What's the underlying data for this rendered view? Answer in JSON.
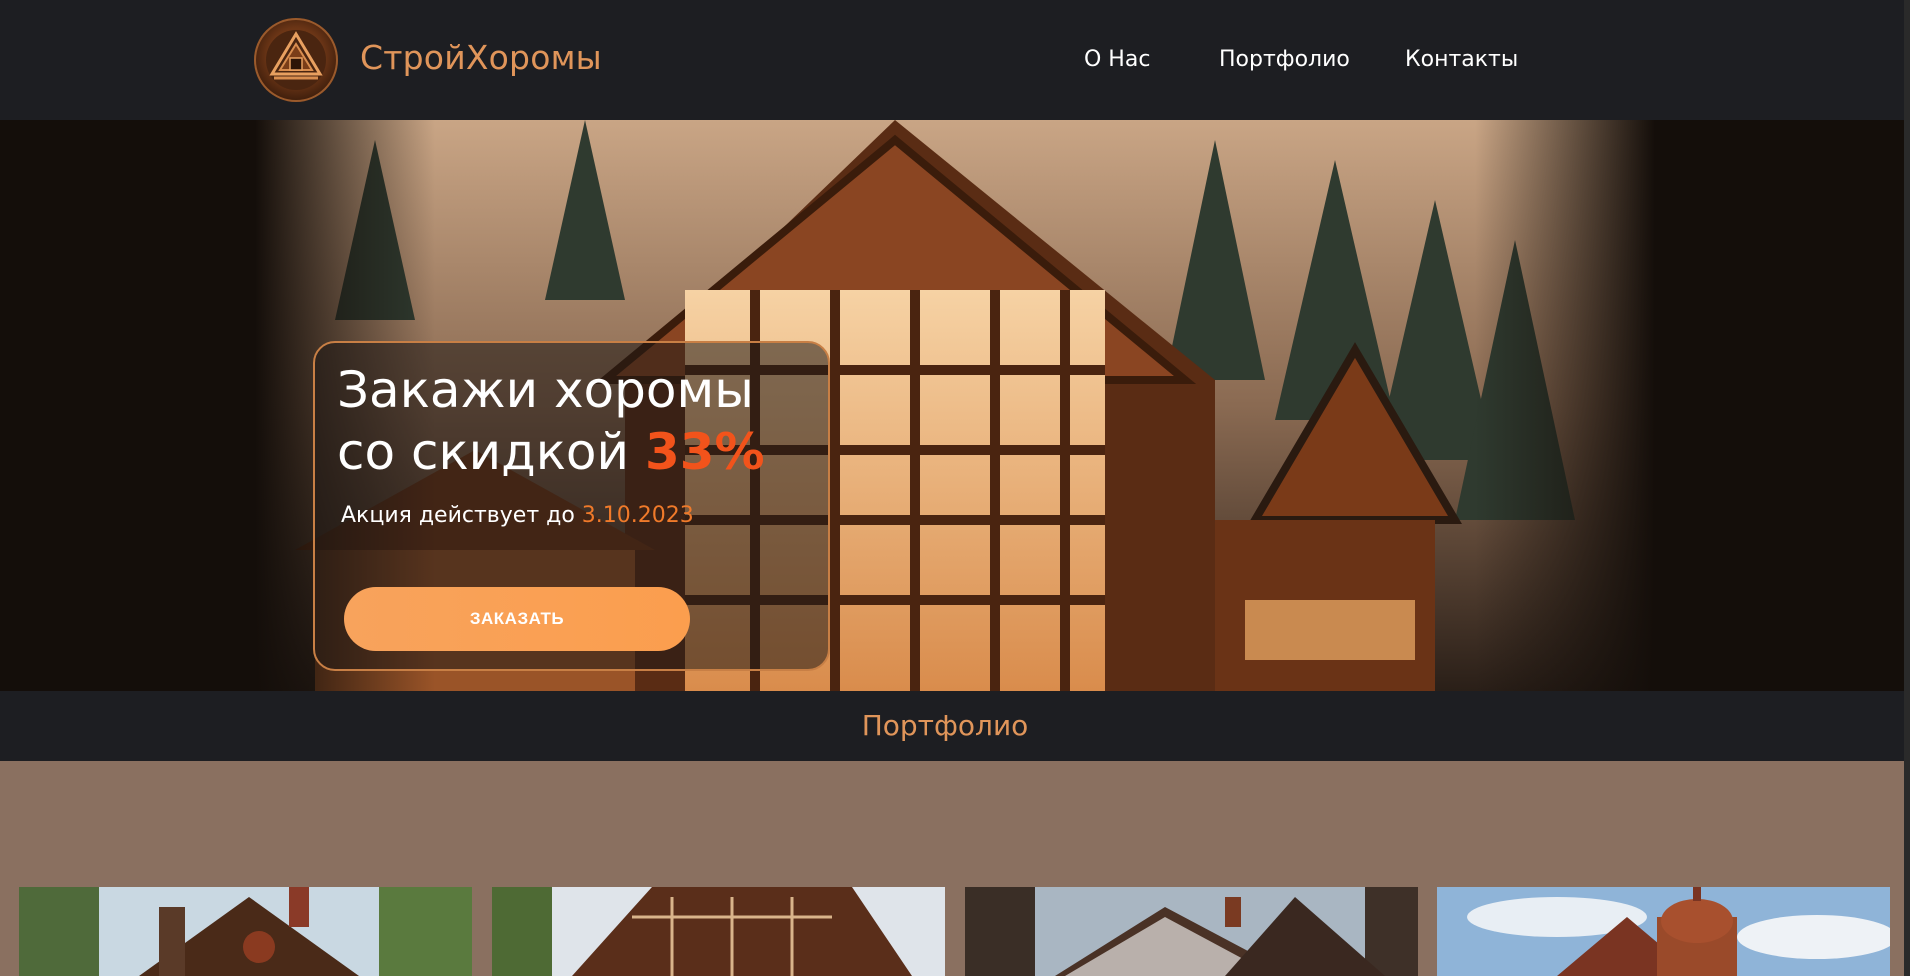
{
  "header": {
    "brand": "СтройХоромы",
    "nav": [
      "О Нас",
      "Портфолио",
      "Контакты"
    ]
  },
  "hero": {
    "title_text": "Закажи хоромы со скидкой",
    "discount": "33%",
    "subtitle_prefix": "Акция действует до",
    "end_date": "3.10.2023",
    "cta_label": "ЗАКАЗАТЬ"
  },
  "portfolio": {
    "title": "Портфолио"
  },
  "colors": {
    "header_bg": "#1d1e22",
    "accent": "#e0955a",
    "discount": "#f2531b",
    "button": "#fb9e4e",
    "section_bg": "#8a7060"
  }
}
